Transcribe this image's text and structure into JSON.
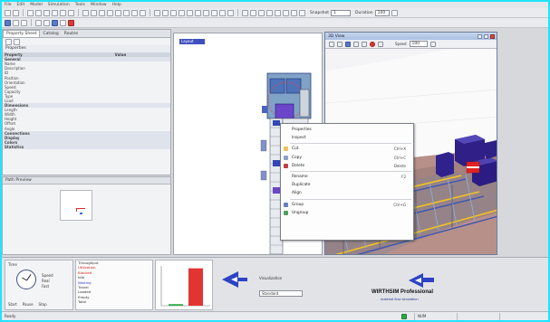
{
  "menubar": [
    "File",
    "Edit",
    "Model",
    "Simulation",
    "Tools",
    "Window",
    "Help"
  ],
  "toolbar": {
    "field1_label": "Snapshot",
    "field1_value": "1",
    "field2_label": "Duration",
    "field2_value": "100"
  },
  "left_panel": {
    "tabs": [
      "Property Sheet",
      "Catalog",
      "Routes"
    ],
    "properties_title": "Properties",
    "columns": [
      "Property",
      "Value"
    ],
    "rows": [
      {
        "type": "cat",
        "k": "General",
        "v": ""
      },
      {
        "type": "row",
        "k": "Name",
        "v": ""
      },
      {
        "type": "row",
        "k": "Description",
        "v": ""
      },
      {
        "type": "row",
        "k": "ID",
        "v": ""
      },
      {
        "type": "row",
        "k": "Position",
        "v": ""
      },
      {
        "type": "row",
        "k": "Orientation",
        "v": ""
      },
      {
        "type": "row",
        "k": "Speed",
        "v": ""
      },
      {
        "type": "row",
        "k": "Capacity",
        "v": ""
      },
      {
        "type": "row",
        "k": "Type",
        "v": ""
      },
      {
        "type": "row",
        "k": "Load",
        "v": ""
      },
      {
        "type": "cat",
        "k": "Dimensions",
        "v": ""
      },
      {
        "type": "row",
        "k": "Length",
        "v": ""
      },
      {
        "type": "row",
        "k": "Width",
        "v": ""
      },
      {
        "type": "row",
        "k": "Height",
        "v": ""
      },
      {
        "type": "row",
        "k": "Offset",
        "v": ""
      },
      {
        "type": "row",
        "k": "Angle",
        "v": ""
      },
      {
        "type": "cat",
        "k": "Connections",
        "v": ""
      },
      {
        "type": "cat",
        "k": "Display",
        "v": ""
      },
      {
        "type": "cat",
        "k": "Colors",
        "v": ""
      },
      {
        "type": "cat",
        "k": "Statistics",
        "v": ""
      }
    ]
  },
  "path_panel": {
    "title": "Path Preview"
  },
  "canvas_tab": "Layout",
  "view3d": {
    "title": "3D View",
    "speed_label": "Speed",
    "speed_value": "100"
  },
  "context_menu": {
    "items": [
      {
        "label": "Properties",
        "shortcut": ""
      },
      {
        "label": "Inspect",
        "shortcut": ""
      },
      {
        "sep": true
      },
      {
        "label": "Cut",
        "shortcut": "Ctrl+X",
        "icon": "#f0c060"
      },
      {
        "label": "Copy",
        "shortcut": "Ctrl+C",
        "icon": "#88a0d0"
      },
      {
        "label": "Delete",
        "shortcut": "Delete",
        "icon": "#c04040"
      },
      {
        "sep": true
      },
      {
        "label": "Rename",
        "shortcut": "F2"
      },
      {
        "label": "Duplicate",
        "shortcut": ""
      },
      {
        "label": "Align",
        "shortcut": ""
      },
      {
        "sep": true
      },
      {
        "label": "Group",
        "shortcut": "Ctrl+G",
        "icon": "#6080c0"
      },
      {
        "label": "Ungroup",
        "shortcut": "",
        "icon": "#50a060"
      }
    ]
  },
  "bottom": {
    "clock_label": "Time",
    "speed_labels": [
      "Speed",
      "Real",
      "Fast"
    ],
    "bottom_row": [
      "Start",
      "Pause",
      "Stop"
    ],
    "stats": [
      {
        "k": "Throughput",
        "cls": "",
        "v": ""
      },
      {
        "k": "Utilization",
        "cls": "red",
        "v": ""
      },
      {
        "k": "Blocked",
        "cls": "red",
        "v": ""
      },
      {
        "k": "Idle",
        "cls": "",
        "v": ""
      },
      {
        "k": "Waiting",
        "cls": "blue",
        "v": ""
      },
      {
        "k": "Travel",
        "cls": "",
        "v": ""
      },
      {
        "k": "Loaded",
        "cls": "",
        "v": ""
      },
      {
        "k": "Empty",
        "cls": "",
        "v": ""
      },
      {
        "k": "Total",
        "cls": "",
        "v": ""
      }
    ],
    "chart": {
      "green_level": 0.04,
      "red_level": 0.94
    },
    "dropdown_label": "Visualization",
    "dropdown_value": "Standard",
    "brand": "WIRTHSIM Professional",
    "brand_sub": "material flow simulation"
  },
  "statusbar": {
    "left": "Ready",
    "segments": [
      "NUM",
      "",
      ""
    ]
  },
  "colors": {
    "background": "#1ee4ff",
    "accent": "#3f4fbf",
    "red": "#e02828"
  }
}
